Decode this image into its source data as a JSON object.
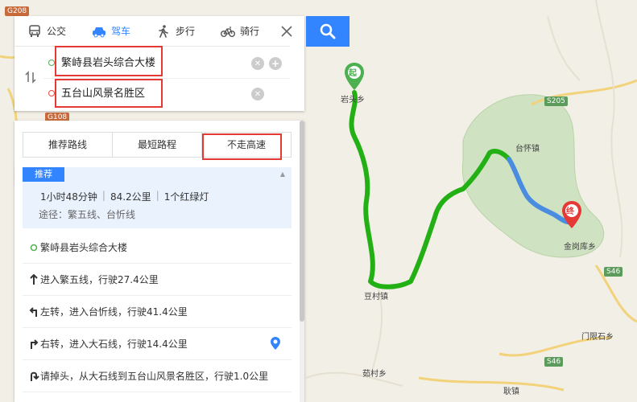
{
  "modes": [
    {
      "label": "公交",
      "icon": "bus-icon"
    },
    {
      "label": "驾车",
      "icon": "car-icon",
      "active": true
    },
    {
      "label": "步行",
      "icon": "walk-icon"
    },
    {
      "label": "骑行",
      "icon": "bike-icon"
    }
  ],
  "route": {
    "start": "繁峙县岩头综合大楼",
    "end": "五台山风景名胜区"
  },
  "tabs": [
    "推荐路线",
    "最短路程",
    "不走高速"
  ],
  "summary": {
    "badge": "推荐",
    "time": "1小时48分钟",
    "distance": "84.2公里",
    "lights": "1个红绿灯",
    "via": "途径：繁五线、台忻线"
  },
  "steps": [
    {
      "icon": "start-dot-icon",
      "text": "繁峙县岩头综合大楼"
    },
    {
      "icon": "straight-arrow-icon",
      "text": "进入繁五线，行驶27.4公里"
    },
    {
      "icon": "turn-left-icon",
      "text": "左转，进入台忻线，行驶41.4公里"
    },
    {
      "icon": "turn-right-icon",
      "text": "右转，进入大石线，行驶14.4公里"
    },
    {
      "icon": "u-turn-icon",
      "text": "请掉头，从大石线到五台山风景名胜区，行驶1.0公里"
    }
  ],
  "map": {
    "start_marker": "起",
    "end_marker": "终",
    "labels": {
      "yantou": "岩头乡",
      "taihuai": "台怀镇",
      "jingangku": "金岗库乡",
      "doucun": "豆村镇",
      "menxianshi": "门限石乡",
      "rucun": "茹村乡",
      "gengzhen": "耿镇"
    },
    "roads": {
      "g208": "G208",
      "s205": "S205",
      "s46a": "S46",
      "s46b": "S46",
      "g_left": "G108"
    },
    "route_color": "#22b014",
    "route_color_alt": "#4a8de0"
  }
}
